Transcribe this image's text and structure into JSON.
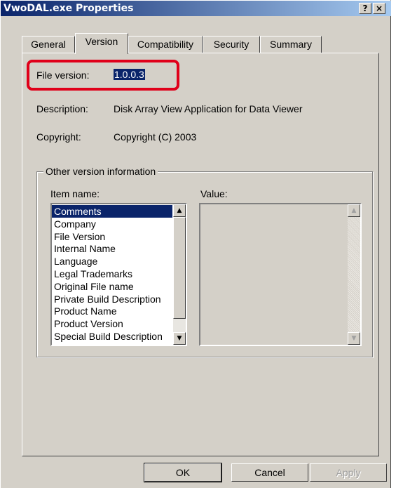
{
  "window": {
    "title": "VwoDAL.exe Properties",
    "help_btn": "?",
    "close_btn": "×"
  },
  "tabs": [
    "General",
    "Version",
    "Compatibility",
    "Security",
    "Summary"
  ],
  "active_tab": "Version",
  "version": {
    "file_version_label": "File version:",
    "file_version_value": "1.0.0.3",
    "description_label": "Description:",
    "description_value": "Disk Array View Application for Data Viewer",
    "copyright_label": "Copyright:",
    "copyright_value": "Copyright (C) 2003"
  },
  "other_info": {
    "group_title": "Other version information",
    "item_name_label": "Item name:",
    "value_label": "Value:",
    "items": [
      "Comments",
      "Company",
      "File Version",
      "Internal Name",
      "Language",
      "Legal Trademarks",
      "Original File name",
      "Private Build Description",
      "Product Name",
      "Product Version",
      "Special Build Description"
    ],
    "selected_item": "Comments"
  },
  "buttons": {
    "ok": "OK",
    "cancel": "Cancel",
    "apply": "Apply"
  },
  "colors": {
    "highlight_border": "#e0001a",
    "selection": "#0a246a",
    "dialog_bg": "#d4d0c8"
  }
}
